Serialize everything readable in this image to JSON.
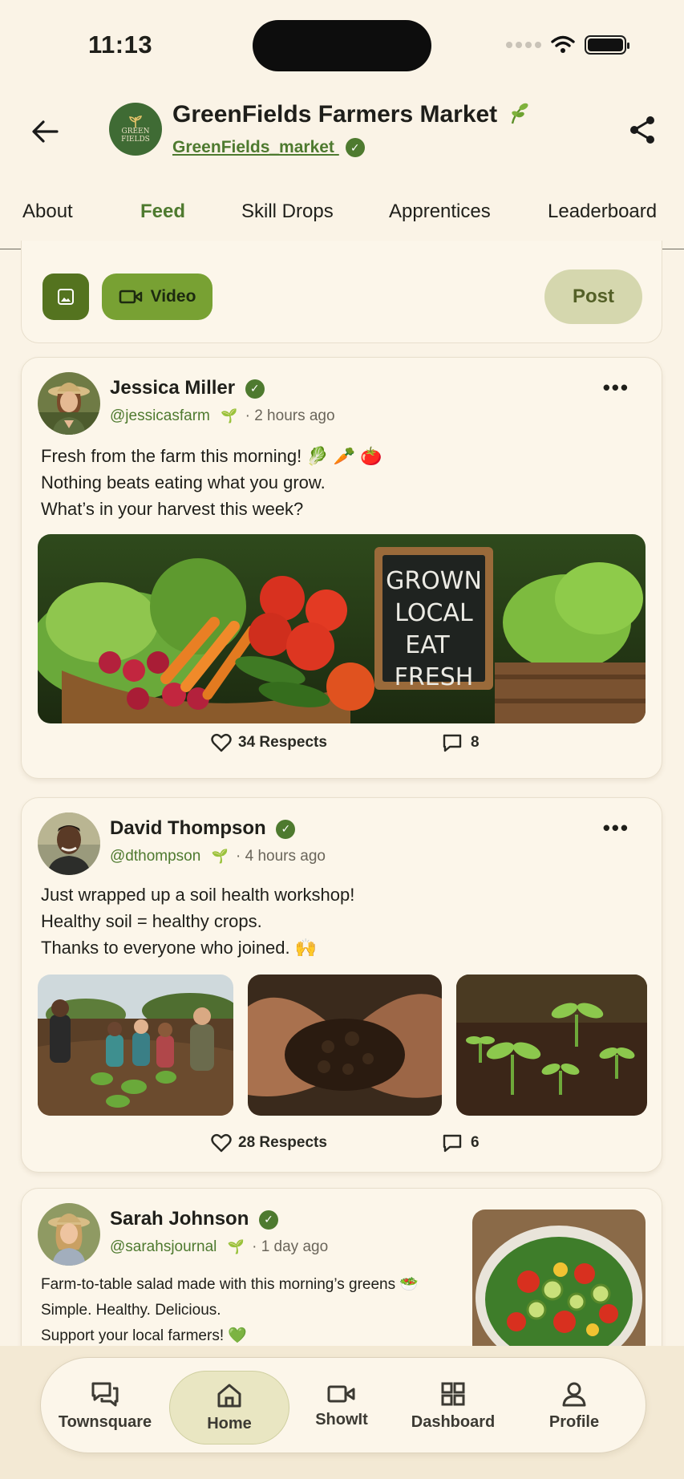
{
  "status_bar": {
    "time": "11:13"
  },
  "header": {
    "title": "GreenFields Farmers Market",
    "handle": "GreenFields_market",
    "logo_text_1": "GREEN",
    "logo_text_2": "FIELDS"
  },
  "tabs": [
    {
      "label": "About"
    },
    {
      "label": "Feed"
    },
    {
      "label": "Skill Drops"
    },
    {
      "label": "Apprentices"
    },
    {
      "label": "Leaderboard"
    }
  ],
  "active_tab": "Feed",
  "composer": {
    "video_label": "Video",
    "post_label": "Post"
  },
  "posts": [
    {
      "author": "Jessica Miller",
      "handle": "@jessicasfarm",
      "time": "· 2 hours ago",
      "lines": [
        "Fresh from the farm this morning! 🥬 🥕 🍅",
        "Nothing beats eating what you grow.",
        "What’s in your harvest this week?"
      ],
      "sign_lines": [
        "GROWN",
        "LOCAL",
        "EAT",
        "FRESH"
      ],
      "respects": "34 Respects",
      "comments": "8"
    },
    {
      "author": "David Thompson",
      "handle": "@dthompson",
      "time": "· 4 hours ago",
      "lines": [
        "Just wrapped up a soil health workshop!",
        "Healthy soil = healthy crops.",
        "Thanks to everyone who joined. 🙌"
      ],
      "respects": "28 Respects",
      "comments": "6"
    },
    {
      "author": "Sarah Johnson",
      "handle": "@sarahsjournal",
      "time": "· 1 day ago",
      "lines": [
        "Farm-to-table salad made with this morning’s greens 🥗",
        "Simple. Healthy. Delicious.",
        "Support your local farmers! 💚"
      ]
    }
  ],
  "bottom_nav": [
    {
      "label": "Townsquare",
      "icon": "chat-bubbles-icon"
    },
    {
      "label": "Home",
      "icon": "home-icon"
    },
    {
      "label": "ShowIt",
      "icon": "video-camera-icon"
    },
    {
      "label": "Dashboard",
      "icon": "grid-icon"
    },
    {
      "label": "Profile",
      "icon": "person-icon"
    }
  ],
  "colors": {
    "background": "#faf3e6",
    "accent_green": "#4e7a2f",
    "video_button": "#78a133",
    "post_button": "#d5d7ae"
  }
}
